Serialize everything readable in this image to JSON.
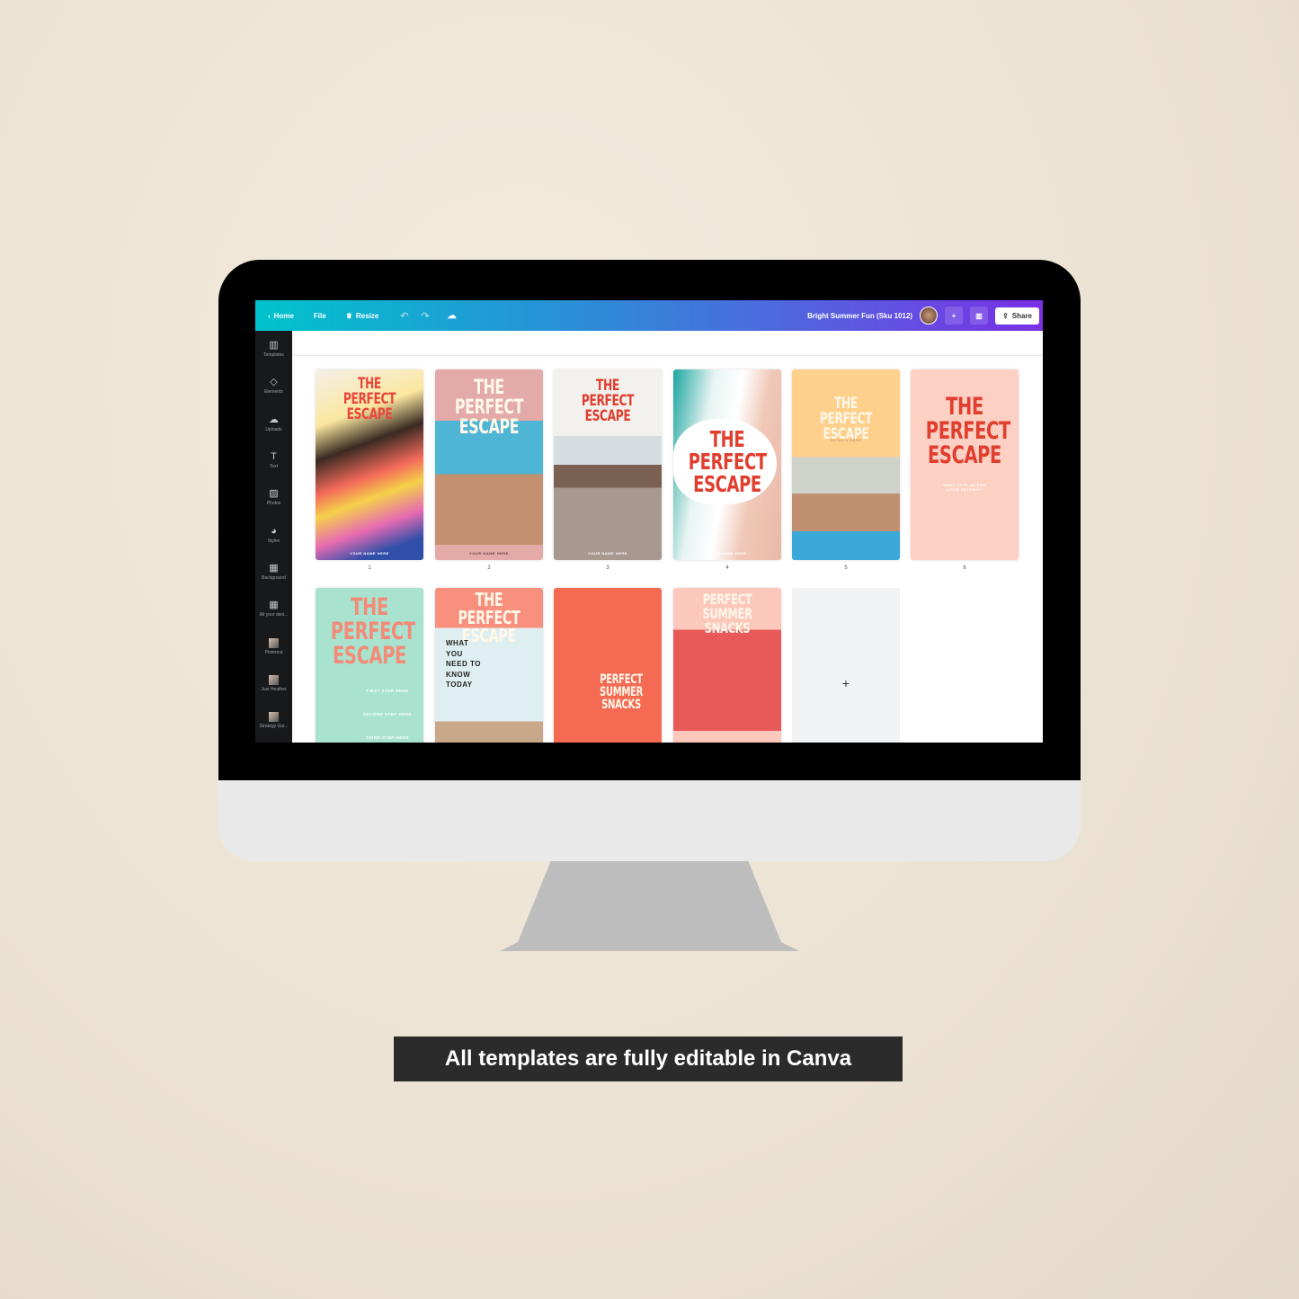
{
  "toolbar": {
    "home": "Home",
    "file": "File",
    "resize": "Resize",
    "title": "Bright Summer Fun (Sku 1012)",
    "share": "Share"
  },
  "sidebar": [
    "Templates",
    "Elements",
    "Uploads",
    "Text",
    "Photos",
    "Styles",
    "Background",
    "All your desi...",
    "Pinterest",
    "Just Heather",
    "Strategy Gui..."
  ],
  "pages": [
    {
      "num": "1",
      "title": "THE PERFECT\nESCAPE",
      "sub": "YOUR NAME HERE"
    },
    {
      "num": "2",
      "title": "THE PERFECT\nESCAPE",
      "sub": "YOUR NAME HERE"
    },
    {
      "num": "3",
      "title": "THE PERFECT\nESCAPE",
      "sub": "YOUR NAME HERE"
    },
    {
      "num": "4",
      "title": "THE\nPERFECT\nESCAPE",
      "sub": "YOUR NAME HERE"
    },
    {
      "num": "5",
      "title": "THE PERFECT\nESCAPE",
      "sub": "DETAILS HERE"
    },
    {
      "num": "6",
      "title": "THE\nPERFECT\nESCAPE",
      "sub": "WHAT TO PLAN FOR\nA FUN GETAWAY!"
    },
    {
      "title": "THE\nPERFECT\nESCAPE",
      "steps": [
        "FIRST STEP HERE",
        "SECOND STEP HERE",
        "THIRD STEP HERE"
      ]
    },
    {
      "title": "THE PERFECT\nESCAPE",
      "sub": "WHAT\nYOU\nNEED TO\nKNOW\nTODAY"
    },
    {
      "title": "PERFECT\nSUMMER\nSNACKS"
    },
    {
      "title": "PERFECT SUMMER\nSNACKS"
    }
  ],
  "add_page": "+",
  "caption": "All templates are fully editable in Canva"
}
